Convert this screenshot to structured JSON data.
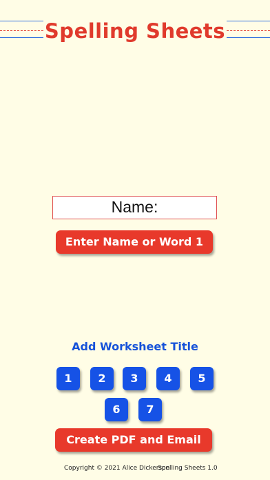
{
  "header": {
    "title": "Spelling Sheets"
  },
  "main": {
    "name_field_text": "Name:",
    "enter_button_label": "Enter Name or Word 1",
    "add_title_label": "Add Worksheet Title",
    "sheet_numbers": [
      "1",
      "2",
      "3",
      "4",
      "5",
      "6",
      "7"
    ],
    "create_button_label": "Create PDF and Email"
  },
  "footer": {
    "copyright": "Copyright © 2021 Alice Dickerson",
    "version": "Spelling Sheets 1.0"
  },
  "colors": {
    "background": "#fffde6",
    "accent_red": "#e8392b",
    "accent_blue": "#1652e6",
    "guide_blue": "#2f6fe0"
  }
}
